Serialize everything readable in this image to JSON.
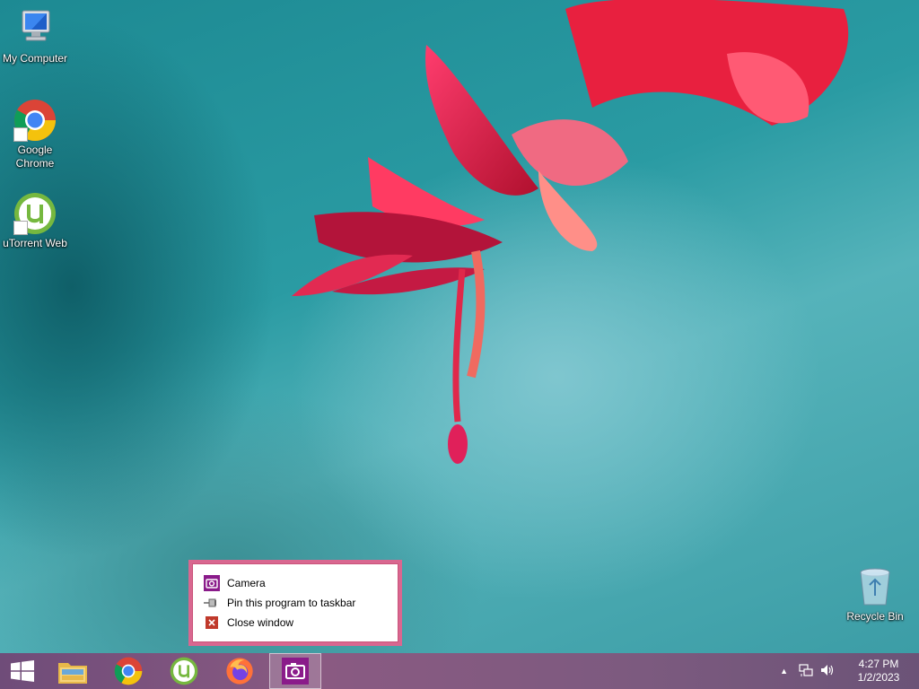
{
  "desktop": {
    "icons": [
      {
        "label": "My Computer",
        "icon": "computer-icon"
      },
      {
        "label_line1": "Google",
        "label_line2": "Chrome",
        "icon": "chrome-icon"
      },
      {
        "label": "uTorrent Web",
        "icon": "utorrent-icon"
      },
      {
        "label": "Recycle Bin",
        "icon": "recycle-bin-icon"
      }
    ]
  },
  "context_menu": {
    "items": [
      {
        "label": "Camera",
        "icon": "camera-icon"
      },
      {
        "label": "Pin this program to taskbar",
        "icon": "pin-icon"
      },
      {
        "label": "Close window",
        "icon": "close-icon"
      }
    ]
  },
  "taskbar": {
    "buttons": [
      {
        "icon": "windows-start-icon"
      },
      {
        "icon": "file-explorer-icon"
      },
      {
        "icon": "chrome-icon"
      },
      {
        "icon": "utorrent-icon"
      },
      {
        "icon": "firefox-icon"
      },
      {
        "icon": "camera-icon",
        "active": true
      }
    ],
    "tray": {
      "time": "4:27 PM",
      "date": "1/2/2023",
      "icons": [
        "show-hidden-icons-arrow-icon",
        "network-icon",
        "volume-icon"
      ]
    }
  },
  "colors": {
    "taskbar": "#7c5a7f",
    "menu_border": "#d96790",
    "camera_accent": "#8a1b8a"
  }
}
